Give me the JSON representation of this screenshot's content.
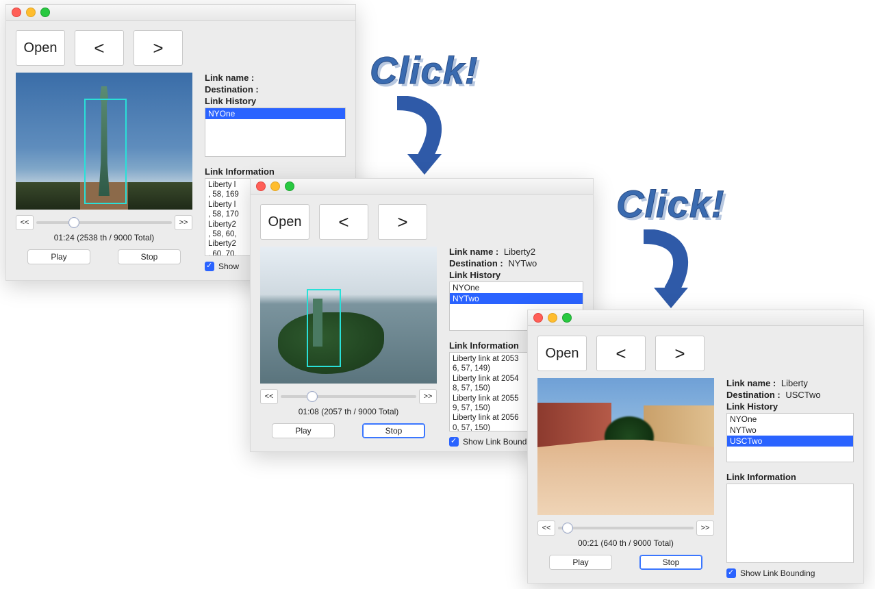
{
  "clickart_text": "Click!",
  "windows": [
    {
      "id": "w1",
      "toolbar": {
        "open": "Open",
        "prev": "<",
        "next": ">"
      },
      "link_name_label": "Link name :",
      "link_name_value": "",
      "destination_label": "Destination :",
      "destination_value": "",
      "history_label": "Link History",
      "history_items": [
        "NYOne"
      ],
      "history_selected_index": 0,
      "link_info_label": "Link Information",
      "link_info_lines": [
        "Liberty l",
        ", 58, 169",
        "Liberty l",
        ", 58, 170",
        "Liberty2",
        ", 58, 60,",
        "Liberty2",
        ", 60, 70,"
      ],
      "nav_back": "<<",
      "nav_fwd": ">>",
      "slider_percent": 28,
      "timecode": "01:24 (2538 th / 9000 Total)",
      "play_label": "Play",
      "stop_label": "Stop",
      "stop_active": false,
      "checkbox_label": "Show"
    },
    {
      "id": "w2",
      "toolbar": {
        "open": "Open",
        "prev": "<",
        "next": ">"
      },
      "link_name_label": "Link name :",
      "link_name_value": "Liberty2",
      "destination_label": "Destination :",
      "destination_value": "NYTwo",
      "history_label": "Link History",
      "history_items": [
        "NYOne",
        "NYTwo"
      ],
      "history_selected_index": 1,
      "link_info_label": "Link Information",
      "link_info_lines": [
        "Liberty link at 2053",
        "6, 57, 149)",
        "Liberty link at 2054",
        "8, 57, 150)",
        "Liberty link at 2055",
        "9, 57, 150)",
        "Liberty link at 2056",
        "0, 57, 150)"
      ],
      "nav_back": "<<",
      "nav_fwd": ">>",
      "slider_percent": 23,
      "timecode": "01:08 (2057 th / 9000 Total)",
      "play_label": "Play",
      "stop_label": "Stop",
      "stop_active": true,
      "checkbox_label": "Show Link Bound"
    },
    {
      "id": "w3",
      "toolbar": {
        "open": "Open",
        "prev": "<",
        "next": ">"
      },
      "link_name_label": "Link name :",
      "link_name_value": "Liberty",
      "destination_label": "Destination :",
      "destination_value": "USCTwo",
      "history_label": "Link History",
      "history_items": [
        "NYOne",
        "NYTwo",
        "USCTwo"
      ],
      "history_selected_index": 2,
      "link_info_label": "Link Information",
      "link_info_lines": [],
      "nav_back": "<<",
      "nav_fwd": ">>",
      "slider_percent": 7,
      "timecode": "00:21 (640 th / 9000 Total)",
      "play_label": "Play",
      "stop_label": "Stop",
      "stop_active": true,
      "checkbox_label": "Show Link Bounding"
    }
  ]
}
